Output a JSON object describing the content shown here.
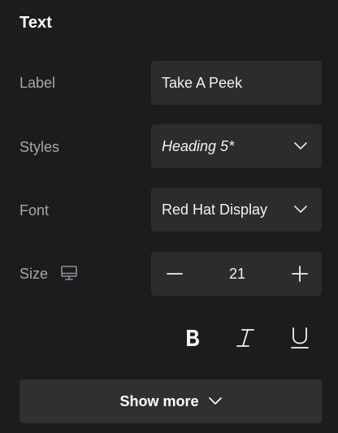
{
  "panel": {
    "title": "Text"
  },
  "label_row": {
    "label": "Label",
    "value": "Take A Peek"
  },
  "styles_row": {
    "label": "Styles",
    "value": "Heading 5*"
  },
  "font_row": {
    "label": "Font",
    "value": "Red Hat Display"
  },
  "size_row": {
    "label": "Size",
    "value": "21",
    "device_icon": "monitor-icon",
    "decrement_icon": "minus-icon",
    "increment_icon": "plus-icon"
  },
  "formatting": {
    "bold_icon": "bold-icon",
    "italic_icon": "italic-icon",
    "underline_icon": "underline-icon"
  },
  "show_more": {
    "label": "Show more",
    "icon": "chevron-down-icon"
  },
  "colors": {
    "background": "#1b1c1e",
    "field": "#2b2c2e",
    "button": "#2f3032",
    "label_text": "#a7a7a9",
    "value_text": "#f1f1f1"
  }
}
